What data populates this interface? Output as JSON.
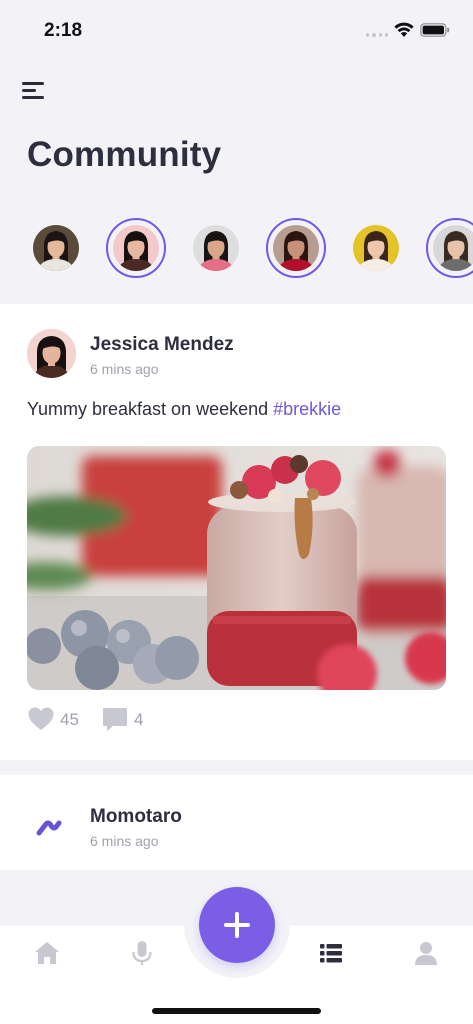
{
  "status_bar": {
    "time": "2:18"
  },
  "header": {
    "title": "Community"
  },
  "stories": [
    {
      "name": "story-1",
      "ring": false,
      "bg": "#5a4a3a",
      "skin": "#e6b89a",
      "hair": "#1b1414",
      "shirt": "#e9e4de"
    },
    {
      "name": "story-2",
      "ring": true,
      "bg": "#f3c9c9",
      "skin": "#e8b79f",
      "hair": "#161010",
      "shirt": "#4b2a24"
    },
    {
      "name": "story-3",
      "ring": false,
      "bg": "#dedede",
      "skin": "#d9a68a",
      "hair": "#181414",
      "shirt": "#e46f86"
    },
    {
      "name": "story-4",
      "ring": true,
      "bg": "#b79c90",
      "skin": "#c8917a",
      "hair": "#2a1510",
      "shirt": "#b3112b"
    },
    {
      "name": "story-5",
      "ring": false,
      "bg": "#e3c327",
      "skin": "#efc6ac",
      "hair": "#3b2418",
      "shirt": "#f4eee4"
    },
    {
      "name": "story-6",
      "ring": true,
      "bg": "#d8d8d8",
      "skin": "#e8c3ac",
      "hair": "#3a2b22",
      "shirt": "#6d6d6d"
    }
  ],
  "post": {
    "author": "Jessica Mendez",
    "time": "6 mins ago",
    "text": "Yummy breakfast on weekend ",
    "hashtag": "#brekkie",
    "likes": "45",
    "comments": "4"
  },
  "post2": {
    "author": "Momotaro",
    "time": "6 mins ago"
  },
  "tab_bar": {
    "items": [
      "home-icon",
      "microphone-icon",
      "add-icon",
      "list-icon",
      "profile-icon"
    ],
    "active": "list-icon"
  },
  "colors": {
    "accent": "#7a5fe6",
    "hashtag": "#6b5bd9",
    "text_primary": "#2d2f3e",
    "text_muted": "#9fa1ad",
    "icon_inactive": "#c7c8d2"
  }
}
